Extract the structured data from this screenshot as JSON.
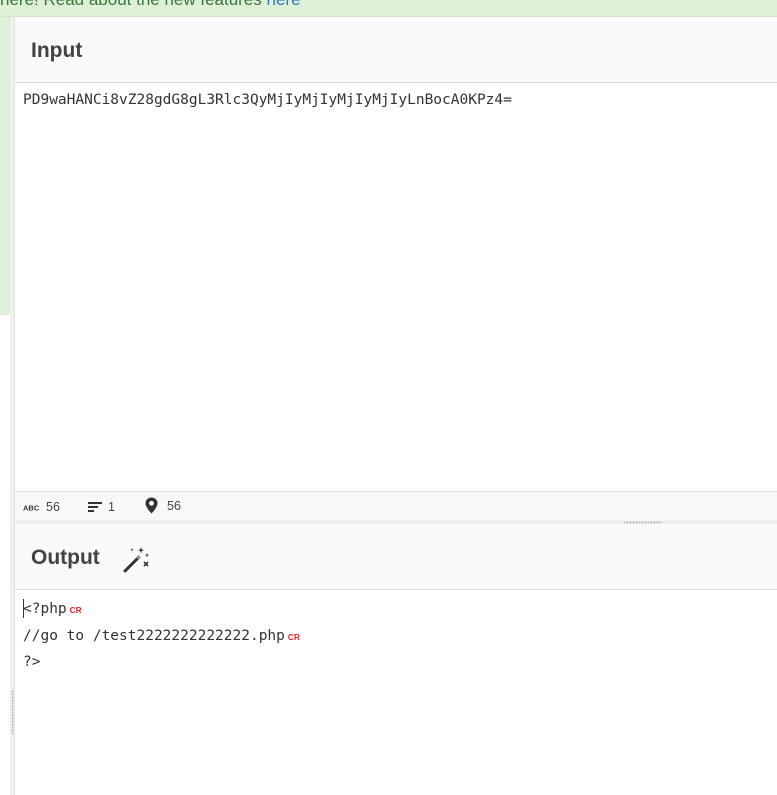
{
  "notice": {
    "text": "here! Read about the new features ",
    "link": "here"
  },
  "input": {
    "title": "Input",
    "value": "PD9waHANCi8vZ28gdG8gL3Rlc3QyMjIyMjIyMjIyMjIyLnBocA0KPz4="
  },
  "status": {
    "chars_icon": "abc-icon",
    "chars": "56",
    "lines_icon": "lines-icon",
    "lines": "1",
    "position_icon": "location-pin-icon",
    "position": "56"
  },
  "output": {
    "title": "Output",
    "magic_icon": "magic-wand-icon",
    "lines": [
      {
        "text": "<?php",
        "marker": "CR"
      },
      {
        "text": "//go to /test2222222222222.php",
        "marker": "CR"
      },
      {
        "text": "?>",
        "marker": ""
      }
    ]
  },
  "colors": {
    "notice_bg": "#dff0d8",
    "notice_text": "#3c763d",
    "link": "#337ab7",
    "cr_marker": "#e02020"
  }
}
